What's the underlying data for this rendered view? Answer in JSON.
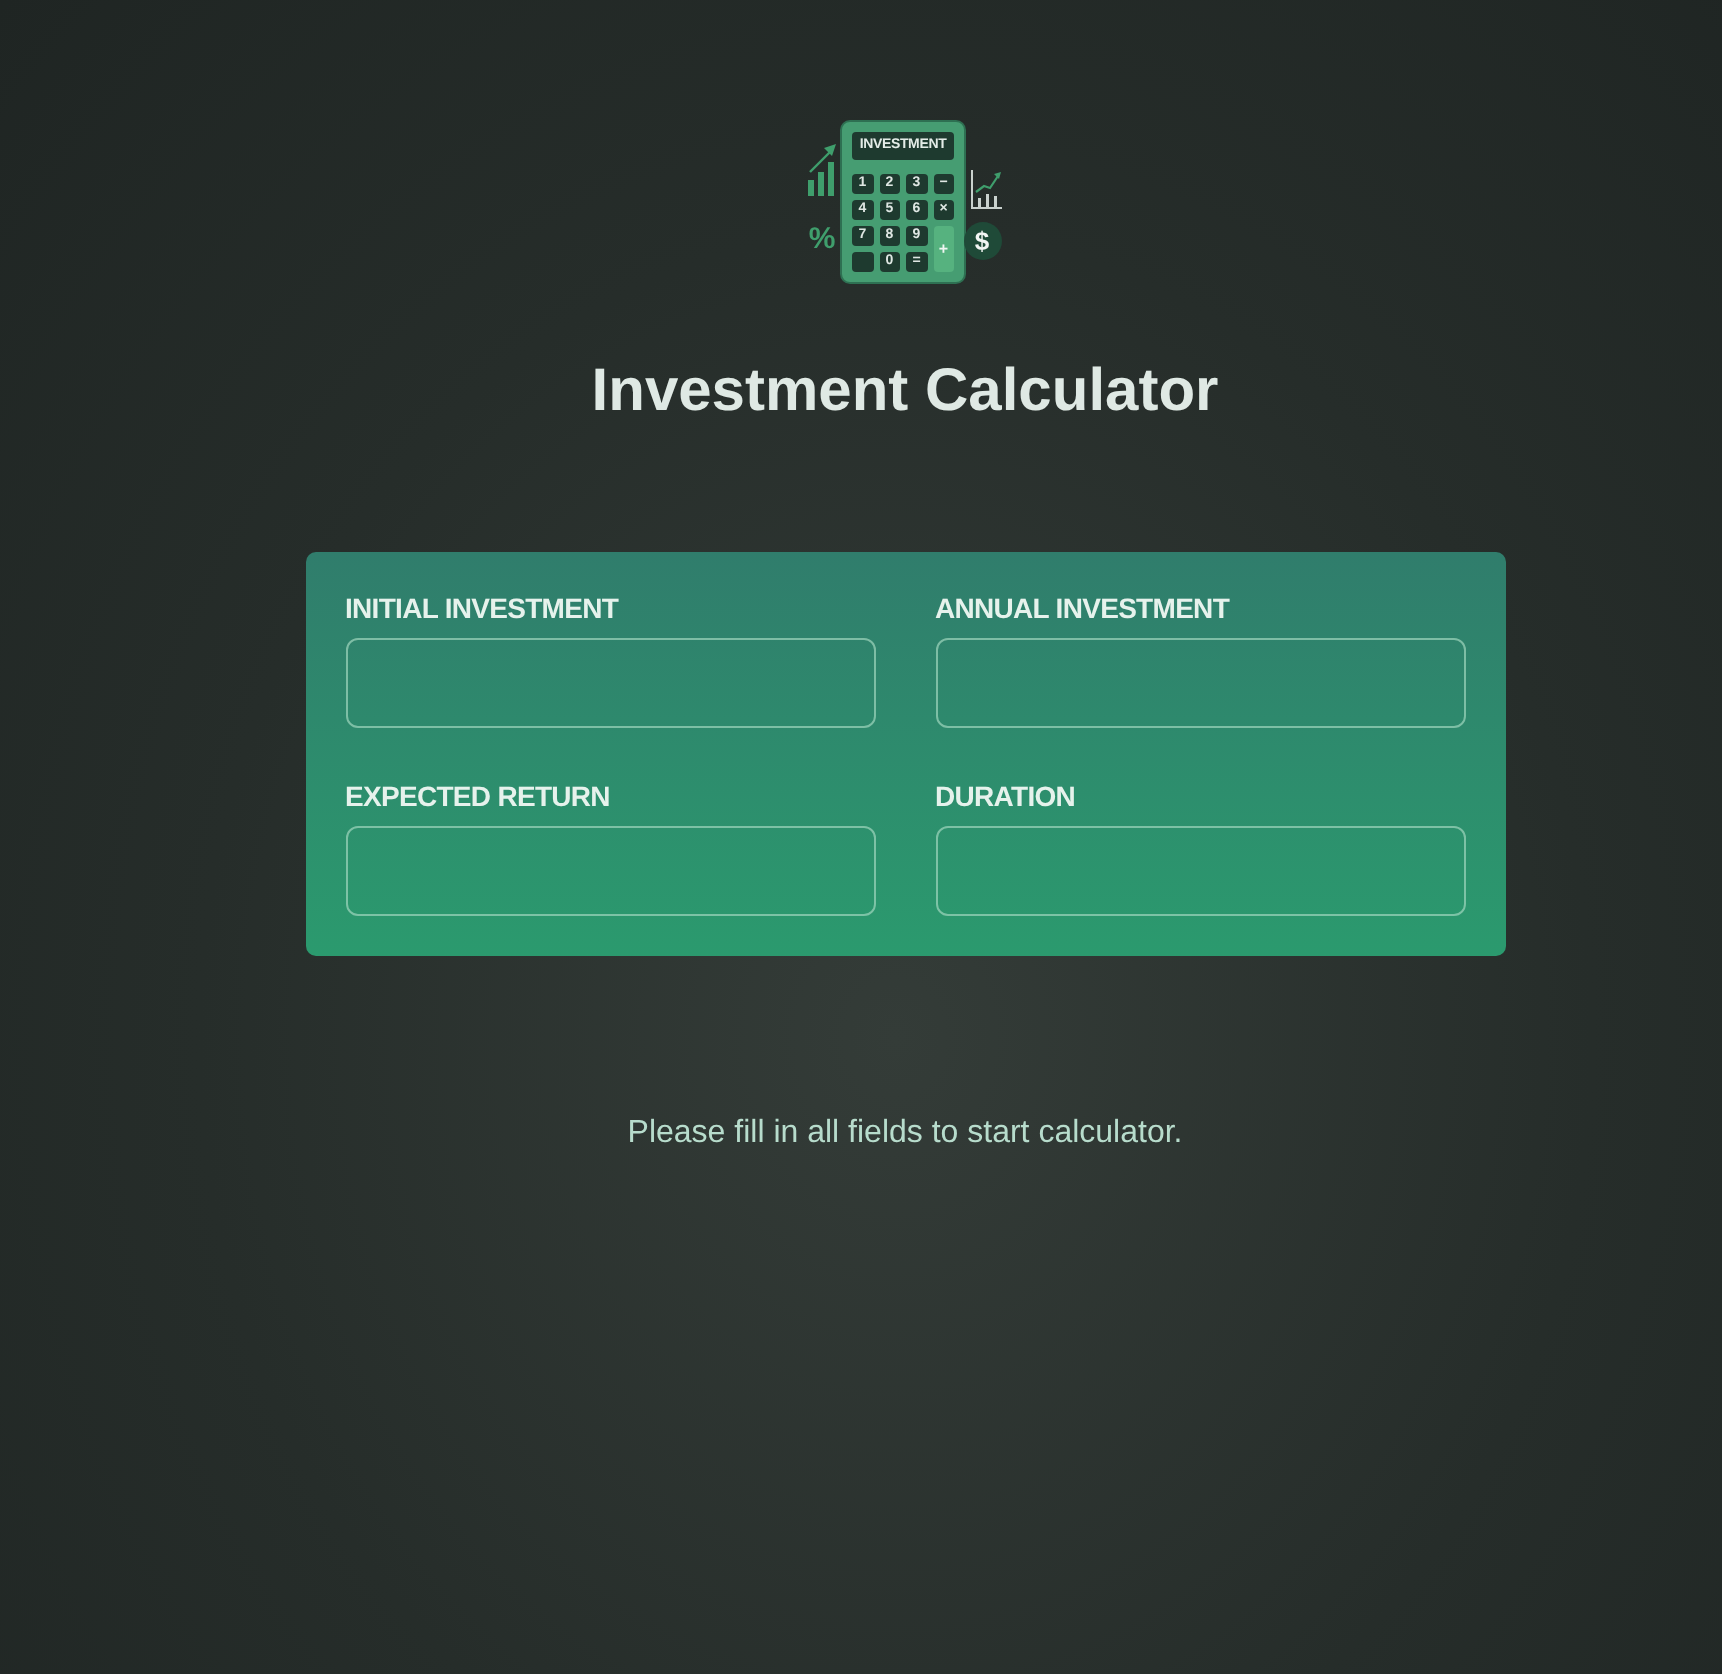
{
  "logo": {
    "screen_text": "INVESTMENT",
    "keys": [
      {
        "kind": "key",
        "label": "1"
      },
      {
        "kind": "key",
        "label": "2"
      },
      {
        "kind": "key",
        "label": "3"
      },
      {
        "kind": "key",
        "label": "−"
      },
      {
        "kind": "key",
        "label": "4"
      },
      {
        "kind": "key",
        "label": "5"
      },
      {
        "kind": "key",
        "label": "6"
      },
      {
        "kind": "key",
        "label": "×"
      },
      {
        "kind": "key",
        "label": "7"
      },
      {
        "kind": "key",
        "label": "8"
      },
      {
        "kind": "key",
        "label": "9"
      },
      {
        "kind": "tall",
        "label": "+"
      },
      {
        "kind": "blank"
      },
      {
        "kind": "key",
        "label": "0"
      },
      {
        "kind": "key",
        "label": "="
      }
    ],
    "percent_sign": "%",
    "dollar_sign": "$"
  },
  "title": "Investment Calculator",
  "form": {
    "fields": [
      {
        "label": "INITIAL INVESTMENT"
      },
      {
        "label": "ANNUAL INVESTMENT"
      },
      {
        "label": "EXPECTED RETURN"
      },
      {
        "label": "DURATION"
      }
    ]
  },
  "message": "Please fill in all fields to start calculator."
}
